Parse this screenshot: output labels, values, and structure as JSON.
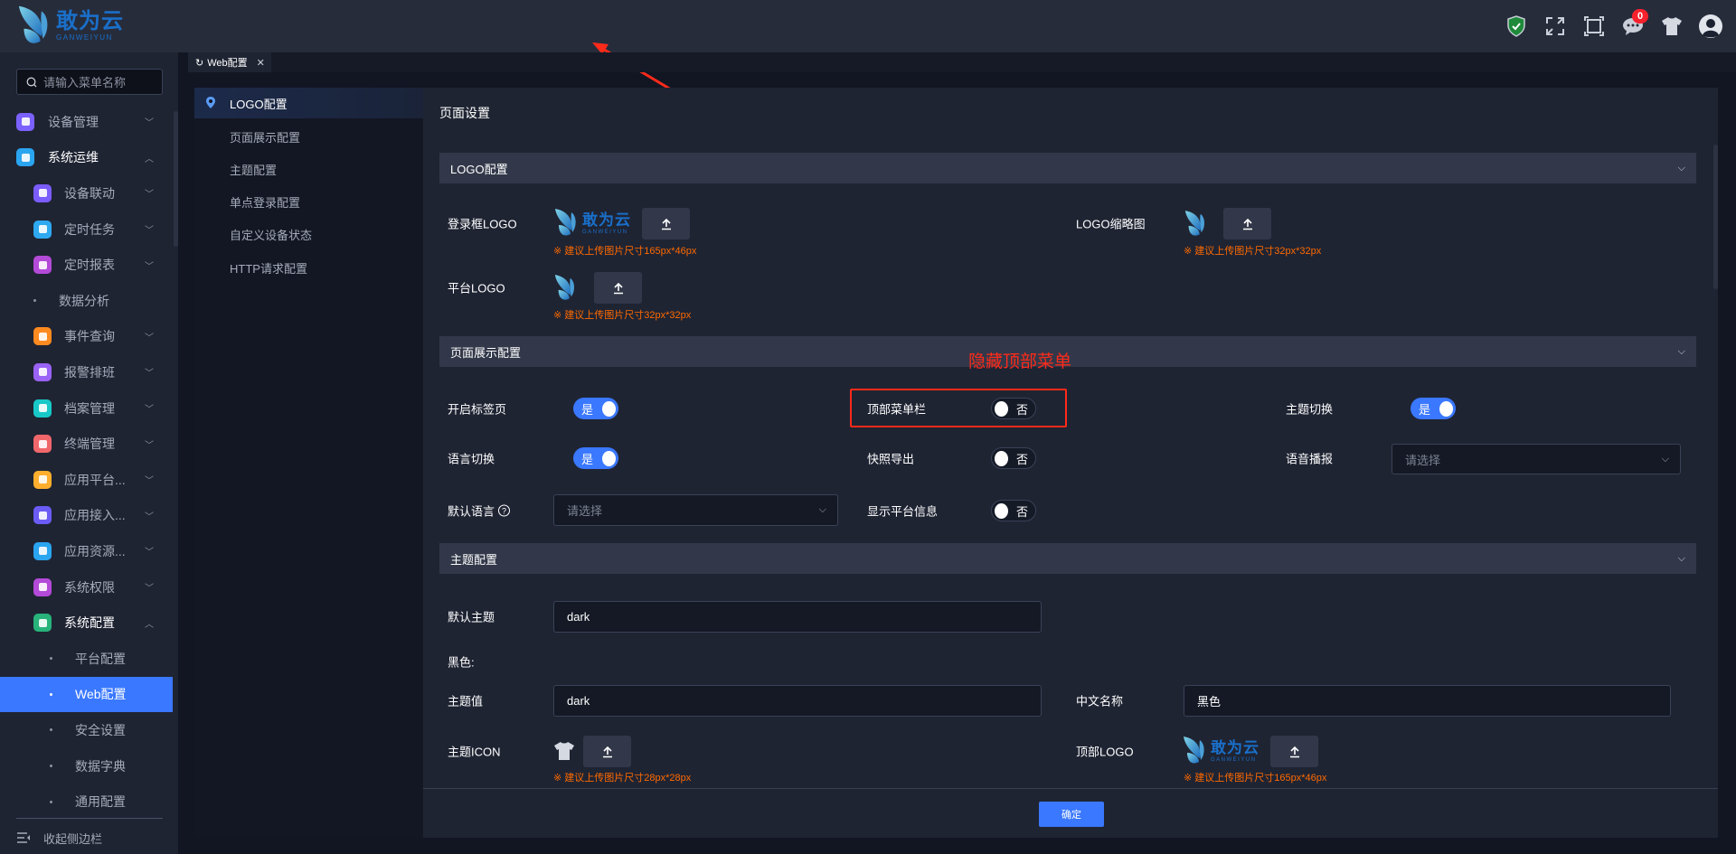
{
  "brand": {
    "name": "敢为云",
    "sub": "GANWEIYUN"
  },
  "header": {
    "message_count": "0",
    "icons": [
      "shield-check-icon",
      "expand-icon",
      "fullscreen-icon",
      "chat-icon",
      "theme-shirt-icon",
      "user-avatar-icon"
    ]
  },
  "sidebar": {
    "search_placeholder": "请输入菜单名称",
    "items": [
      {
        "label": "设备管理",
        "level": 1,
        "color": "#7b61ff",
        "chev": "down"
      },
      {
        "label": "系统运维",
        "level": 1,
        "color": "#2aa5f0",
        "chev": "up",
        "open": true
      },
      {
        "label": "设备联动",
        "level": 2,
        "color": "#7a5cff",
        "chev": "down"
      },
      {
        "label": "定时任务",
        "level": 2,
        "color": "#2ea8f0",
        "chev": "down"
      },
      {
        "label": "定时报表",
        "level": 2,
        "color": "#b44ad8",
        "chev": "down"
      },
      {
        "label": "数据分析",
        "level": "leaf2"
      },
      {
        "label": "事件查询",
        "level": 2,
        "color": "#ff8a1f",
        "chev": "down"
      },
      {
        "label": "报警排班",
        "level": 2,
        "color": "#9a62f5",
        "chev": "down"
      },
      {
        "label": "档案管理",
        "level": 2,
        "color": "#18c8c8",
        "chev": "down"
      },
      {
        "label": "终端管理",
        "level": 2,
        "color": "#f0676b",
        "chev": "down"
      },
      {
        "label": "应用平台...",
        "level": 2,
        "color": "#ffae2e",
        "chev": "down"
      },
      {
        "label": "应用接入...",
        "level": 2,
        "color": "#6a5cf5",
        "chev": "down"
      },
      {
        "label": "应用资源...",
        "level": 2,
        "color": "#2aa5f0",
        "chev": "down"
      },
      {
        "label": "系统权限",
        "level": 2,
        "color": "#b44ad8",
        "chev": "down"
      },
      {
        "label": "系统配置",
        "level": 2,
        "color": "#27b37a",
        "chev": "up",
        "open": true
      },
      {
        "label": "平台配置",
        "level": 3
      },
      {
        "label": "Web配置",
        "level": 3,
        "active": true
      },
      {
        "label": "安全设置",
        "level": 3
      },
      {
        "label": "数据字典",
        "level": 3
      },
      {
        "label": "通用配置",
        "level": 3
      }
    ],
    "collapse_label": "收起侧边栏"
  },
  "tab": {
    "label": "Web配置"
  },
  "subnav": [
    "LOGO配置",
    "页面展示配置",
    "主题配置",
    "单点登录配置",
    "自定义设备状态",
    "HTTP请求配置"
  ],
  "card": {
    "title": "页面设置",
    "logo_section": {
      "title": "LOGO配置",
      "login_logo": {
        "label": "登录框LOGO",
        "hint": "※ 建议上传图片尺寸165px*46px"
      },
      "thumb_logo": {
        "label": "LOGO缩略图",
        "hint": "※ 建议上传图片尺寸32px*32px"
      },
      "platform_logo": {
        "label": "平台LOGO",
        "hint": "※ 建议上传图片尺寸32px*32px"
      }
    },
    "display_section": {
      "title": "页面展示配置",
      "tabs_page": {
        "label": "开启标签页",
        "value": "是"
      },
      "top_menu": {
        "label": "顶部菜单栏",
        "value": "否"
      },
      "theme_switch": {
        "label": "主题切换",
        "value": "是"
      },
      "lang_switch": {
        "label": "语言切换",
        "value": "是"
      },
      "snapshot_export": {
        "label": "快照导出",
        "value": "否"
      },
      "voice_broadcast": {
        "label": "语音播报",
        "placeholder": "请选择"
      },
      "default_lang": {
        "label": "默认语言",
        "placeholder": "请选择"
      },
      "show_platform_info": {
        "label": "显示平台信息",
        "value": "否"
      }
    },
    "theme_section": {
      "title": "主题配置",
      "default_theme": {
        "label": "默认主题",
        "value": "dark"
      },
      "group_label": "黑色:",
      "theme_value": {
        "label": "主题值",
        "value": "dark"
      },
      "cn_name": {
        "label": "中文名称",
        "value": "黑色"
      },
      "theme_icon": {
        "label": "主题ICON",
        "hint": "※ 建议上传图片尺寸28px*28px"
      },
      "top_logo": {
        "label": "顶部LOGO",
        "hint": "※ 建议上传图片尺寸165px*46px"
      }
    },
    "confirm_label": "确定"
  },
  "annotation": {
    "text": "隐藏顶部菜单"
  },
  "colors": {
    "accent": "#3a78ff",
    "hint": "#ff6a00",
    "annotation": "#ff2a1a"
  }
}
